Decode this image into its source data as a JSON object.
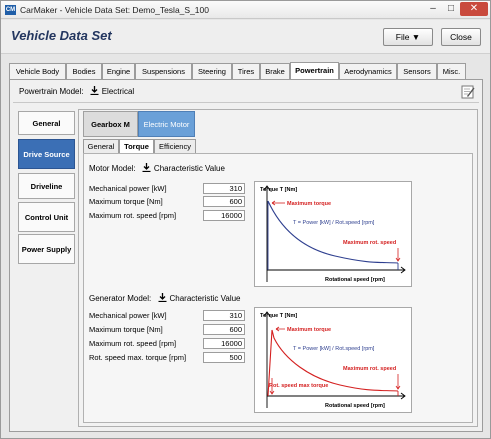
{
  "window": {
    "title": "CarMaker - Vehicle Data Set: Demo_Tesla_S_100",
    "app_icon_text": "CM",
    "minimize_glyph": "–",
    "maximize_glyph": "□",
    "close_glyph": "✕"
  },
  "header": {
    "title": "Vehicle Data Set",
    "file_label": "File ▼",
    "close_label": "Close"
  },
  "main_tabs": [
    "Vehicle Body",
    "Bodies",
    "Engine",
    "Suspensions",
    "Steering",
    "Tires",
    "Brake",
    "Powertrain",
    "Aerodynamics",
    "Sensors",
    "Misc."
  ],
  "active_main_tab": "Powertrain",
  "powertrain_model": {
    "label": "Powertrain Model:",
    "value": "Electrical"
  },
  "nav": [
    "General",
    "Drive Source",
    "Driveline",
    "Control Unit",
    "Power Supply"
  ],
  "active_nav": "Drive Source",
  "sub_tabs": [
    "Gearbox M",
    "Electric Motor"
  ],
  "active_sub_tab": "Electric Motor",
  "inner_tabs": [
    "General",
    "Torque",
    "Efficiency"
  ],
  "active_inner_tab": "Torque",
  "motor": {
    "model_label": "Motor Model:",
    "model_value": "Characteristic Value",
    "fields": [
      {
        "label": "Mechanical power [kW]",
        "value": "310"
      },
      {
        "label": "Maximum torque [Nm]",
        "value": "600"
      },
      {
        "label": "Maximum rot. speed [rpm]",
        "value": "16000"
      }
    ]
  },
  "generator": {
    "model_label": "Generator Model:",
    "model_value": "Characteristic Value",
    "fields": [
      {
        "label": "Mechanical power [kW]",
        "value": "310"
      },
      {
        "label": "Maximum torque [Nm]",
        "value": "600"
      },
      {
        "label": "Maximum rot. speed [rpm]",
        "value": "16000"
      },
      {
        "label": "Rot. speed max. torque [rpm]",
        "value": "500"
      }
    ]
  },
  "motor_chart": {
    "ylabel": "Torque T [Nm]",
    "xlabel": "Rotational speed [rpm]",
    "formula": "T = Power [kW] / Rot.speed [rpm]",
    "max_torque_label": "Maximum torque",
    "max_speed_label": "Maximum rot. speed"
  },
  "generator_chart": {
    "ylabel": "Torque T [Nm]",
    "xlabel": "Rotational speed [rpm]",
    "formula": "T = Power [kW] / Rot.speed [rpm]",
    "max_torque_label": "Maximum torque",
    "max_speed_label": "Maximum rot. speed",
    "speed_max_torque_label": "Rot. speed max torque"
  },
  "colors": {
    "accent_blue": "#3b6fb5",
    "sub_tab_blue": "#6aa0d8",
    "title_blue": "#23365f",
    "annotation_red": "#d42020",
    "motor_curve": "#2e3f8f",
    "generator_curve": "#d42020"
  }
}
